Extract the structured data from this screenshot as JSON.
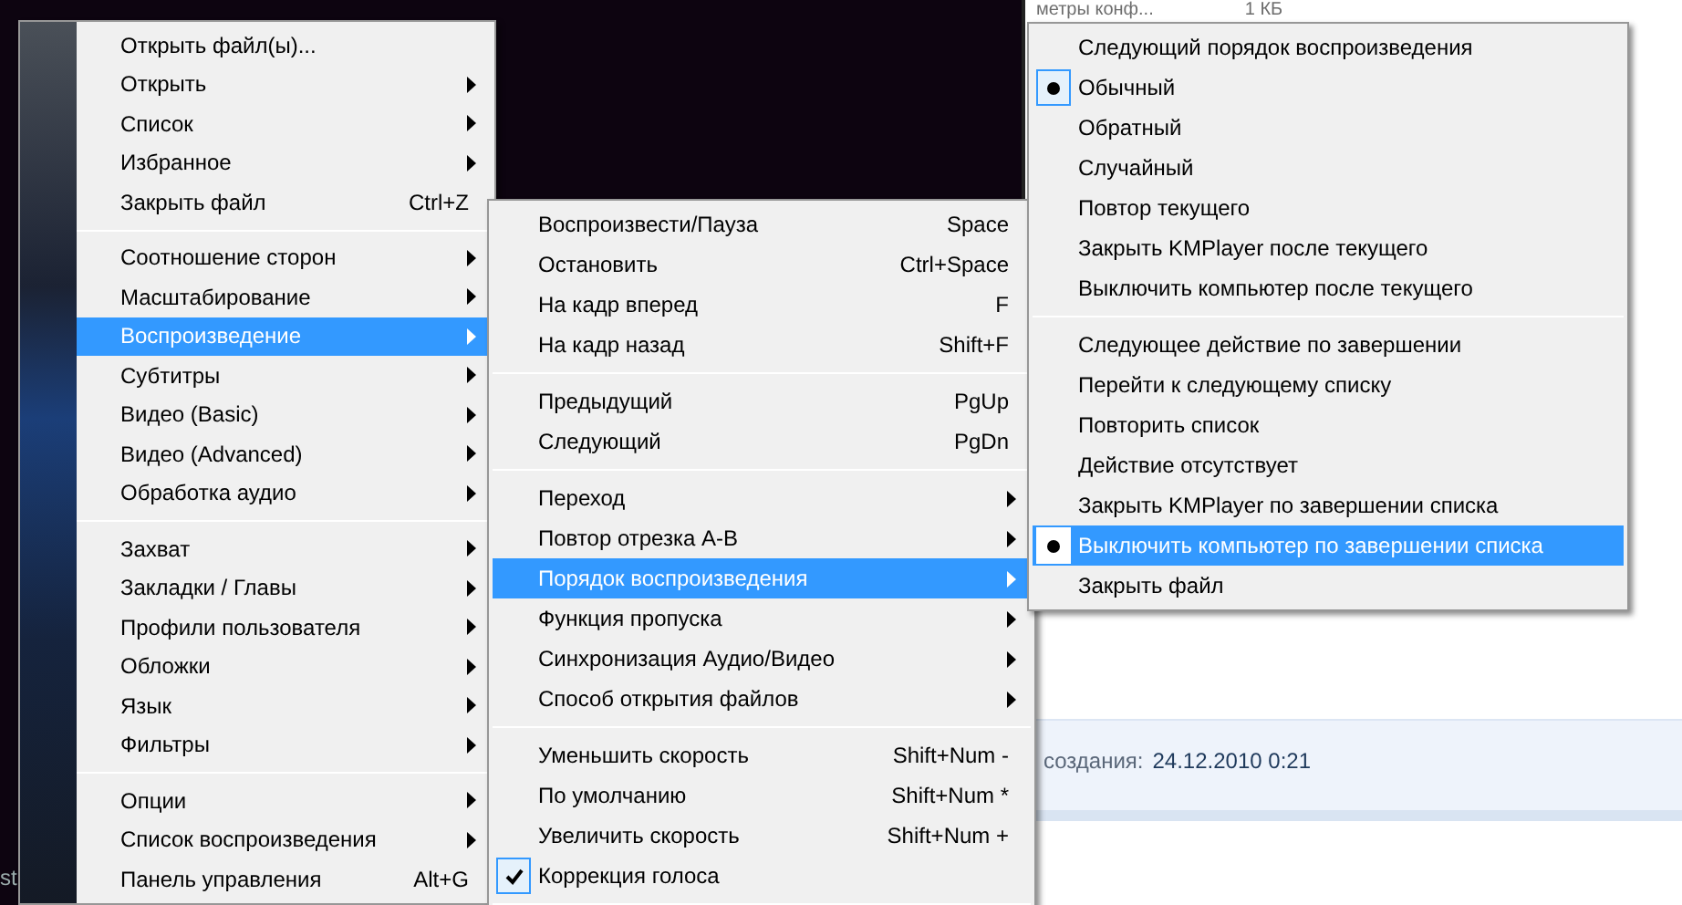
{
  "background_window": {
    "header_name": "метры конф...",
    "header_size": "1 КБ",
    "details_label": "создания:",
    "details_value": "24.12.2010 0:21"
  },
  "desktop_text": "st",
  "menus": [
    {
      "items": [
        {
          "kind": "item",
          "label": "Открыть файл(ы)...",
          "selected": false
        },
        {
          "kind": "item",
          "label": "Открыть",
          "submenu": true,
          "selected": false
        },
        {
          "kind": "item",
          "label": "Список",
          "submenu": true,
          "selected": false
        },
        {
          "kind": "item",
          "label": "Избранное",
          "submenu": true,
          "selected": false
        },
        {
          "kind": "item",
          "label": "Закрыть файл",
          "shortcut": "Ctrl+Z",
          "selected": false
        },
        {
          "kind": "separator"
        },
        {
          "kind": "item",
          "label": "Соотношение сторон",
          "submenu": true,
          "selected": false
        },
        {
          "kind": "item",
          "label": "Масштабирование",
          "submenu": true,
          "selected": false
        },
        {
          "kind": "item",
          "label": "Воспроизведение",
          "submenu": true,
          "selected": true
        },
        {
          "kind": "item",
          "label": "Субтитры",
          "submenu": true,
          "selected": false
        },
        {
          "kind": "item",
          "label": "Видео (Basic)",
          "submenu": true,
          "selected": false
        },
        {
          "kind": "item",
          "label": "Видео (Advanced)",
          "submenu": true,
          "selected": false
        },
        {
          "kind": "item",
          "label": "Обработка аудио",
          "submenu": true,
          "selected": false
        },
        {
          "kind": "separator"
        },
        {
          "kind": "item",
          "label": "Захват",
          "submenu": true,
          "selected": false
        },
        {
          "kind": "item",
          "label": "Закладки / Главы",
          "submenu": true,
          "selected": false
        },
        {
          "kind": "item",
          "label": "Профили пользователя",
          "submenu": true,
          "selected": false
        },
        {
          "kind": "item",
          "label": "Обложки",
          "submenu": true,
          "selected": false
        },
        {
          "kind": "item",
          "label": "Язык",
          "submenu": true,
          "selected": false
        },
        {
          "kind": "item",
          "label": "Фильтры",
          "submenu": true,
          "selected": false
        },
        {
          "kind": "separator"
        },
        {
          "kind": "item",
          "label": "Опции",
          "submenu": true,
          "selected": false
        },
        {
          "kind": "item",
          "label": "Список воспроизведения",
          "submenu": true,
          "selected": false
        },
        {
          "kind": "item",
          "label": "Панель управления",
          "shortcut": "Alt+G",
          "selected": false
        }
      ]
    },
    {
      "items": [
        {
          "kind": "item",
          "label": "Воспроизвести/Пауза",
          "shortcut": "Space",
          "selected": false
        },
        {
          "kind": "item",
          "label": "Остановить",
          "shortcut": "Ctrl+Space",
          "selected": false
        },
        {
          "kind": "item",
          "label": "На кадр вперед",
          "shortcut": "F",
          "selected": false
        },
        {
          "kind": "item",
          "label": "На кадр назад",
          "shortcut": "Shift+F",
          "selected": false
        },
        {
          "kind": "separator"
        },
        {
          "kind": "item",
          "label": "Предыдущий",
          "shortcut": "PgUp",
          "selected": false
        },
        {
          "kind": "item",
          "label": "Следующий",
          "shortcut": "PgDn",
          "selected": false
        },
        {
          "kind": "separator"
        },
        {
          "kind": "item",
          "label": "Переход",
          "submenu": true,
          "selected": false
        },
        {
          "kind": "item",
          "label": "Повтор отрезка A-B",
          "submenu": true,
          "selected": false
        },
        {
          "kind": "item",
          "label": "Порядок воспроизведения",
          "submenu": true,
          "selected": true
        },
        {
          "kind": "item",
          "label": "Функция пропуска",
          "submenu": true,
          "selected": false
        },
        {
          "kind": "item",
          "label": "Синхронизация Аудио/Видео",
          "submenu": true,
          "selected": false
        },
        {
          "kind": "item",
          "label": "Способ открытия файлов",
          "submenu": true,
          "selected": false
        },
        {
          "kind": "separator"
        },
        {
          "kind": "item",
          "label": "Уменьшить скорость",
          "shortcut": "Shift+Num -",
          "selected": false
        },
        {
          "kind": "item",
          "label": "По умолчанию",
          "shortcut": "Shift+Num *",
          "selected": false
        },
        {
          "kind": "item",
          "label": "Увеличить скорость",
          "shortcut": "Shift+Num +",
          "selected": false
        },
        {
          "kind": "check",
          "label": "Коррекция голоса",
          "checked": true,
          "selected": false
        },
        {
          "kind": "separator"
        }
      ]
    },
    {
      "items": [
        {
          "kind": "item",
          "label": "Следующий порядок воспроизведения",
          "selected": false
        },
        {
          "kind": "radio",
          "label": "Обычный",
          "checked": true,
          "selected": false
        },
        {
          "kind": "radio",
          "label": "Обратный",
          "checked": false,
          "selected": false
        },
        {
          "kind": "radio",
          "label": "Случайный",
          "checked": false,
          "selected": false
        },
        {
          "kind": "radio",
          "label": "Повтор текущего",
          "checked": false,
          "selected": false
        },
        {
          "kind": "radio",
          "label": "Закрыть KMPlayer после текущего",
          "checked": false,
          "selected": false
        },
        {
          "kind": "radio",
          "label": "Выключить компьютер после текущего",
          "checked": false,
          "selected": false
        },
        {
          "kind": "separator"
        },
        {
          "kind": "item",
          "label": "Следующее действие по завершении",
          "selected": false
        },
        {
          "kind": "radio",
          "label": "Перейти к следующему списку",
          "checked": false,
          "selected": false
        },
        {
          "kind": "radio",
          "label": "Повторить список",
          "checked": false,
          "selected": false
        },
        {
          "kind": "radio",
          "label": "Действие отсутствует",
          "checked": false,
          "selected": false
        },
        {
          "kind": "radio",
          "label": "Закрыть KMPlayer по завершении списка",
          "checked": false,
          "selected": false
        },
        {
          "kind": "radio",
          "label": "Выключить компьютер по завершении списка",
          "checked": true,
          "selected": true
        },
        {
          "kind": "radio",
          "label": "Закрыть файл",
          "checked": false,
          "selected": false
        }
      ]
    }
  ]
}
